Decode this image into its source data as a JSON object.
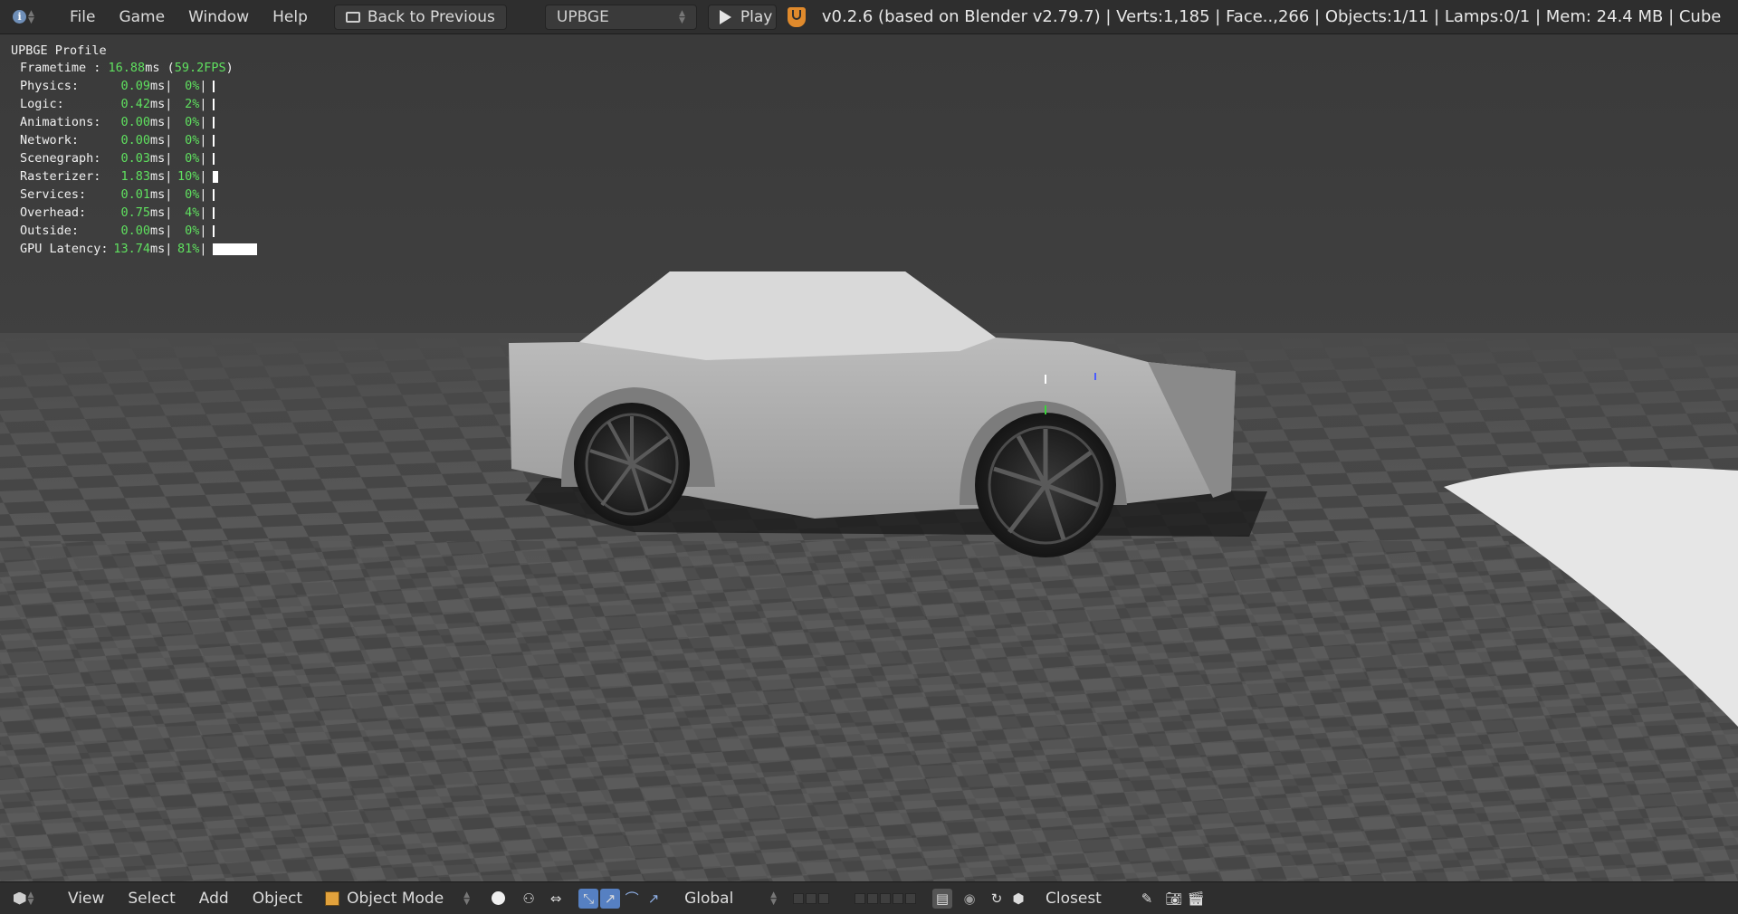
{
  "topbar": {
    "menus": [
      "File",
      "Game",
      "Window",
      "Help"
    ],
    "back_label": "Back to Previous",
    "engine": "UPBGE",
    "play_label": "Play",
    "stats": "v0.2.6 (based on Blender v2.79.7)  | Verts:1,185 | Face..,266 | Objects:1/11 | Lamps:0/1 | Mem: 24.4 MB | Cube"
  },
  "profile": {
    "title": "UPBGE Profile",
    "frametime_label": "Frametime :",
    "frametime_ms": "16.88",
    "frametime_fps": "59.2FPS",
    "rows": [
      {
        "name": "Physics:",
        "ms": "0.09",
        "pct": "0%",
        "fraction": 0.005
      },
      {
        "name": "Logic:",
        "ms": "0.42",
        "pct": "2%",
        "fraction": 0.02
      },
      {
        "name": "Animations:",
        "ms": "0.00",
        "pct": "0%",
        "fraction": 0.0
      },
      {
        "name": "Network:",
        "ms": "0.00",
        "pct": "0%",
        "fraction": 0.0
      },
      {
        "name": "Scenegraph:",
        "ms": "0.03",
        "pct": "0%",
        "fraction": 0.002
      },
      {
        "name": "Rasterizer:",
        "ms": "1.83",
        "pct": "10%",
        "fraction": 0.1
      },
      {
        "name": "Services:",
        "ms": "0.01",
        "pct": "0%",
        "fraction": 0.001
      },
      {
        "name": "Overhead:",
        "ms": "0.75",
        "pct": "4%",
        "fraction": 0.04
      },
      {
        "name": "Outside:",
        "ms": "0.00",
        "pct": "0%",
        "fraction": 0.0
      },
      {
        "name": "GPU Latency:",
        "ms": "13.74",
        "pct": "81%",
        "fraction": 0.81
      }
    ]
  },
  "bottombar": {
    "menus": [
      "View",
      "Select",
      "Add",
      "Object"
    ],
    "mode": "Object Mode",
    "orientation": "Global",
    "snap_target": "Closest"
  },
  "colors": {
    "bar_bg": "#2e2e2e",
    "profile_value": "#5fe05f",
    "selected_tool": "#5680c2"
  }
}
